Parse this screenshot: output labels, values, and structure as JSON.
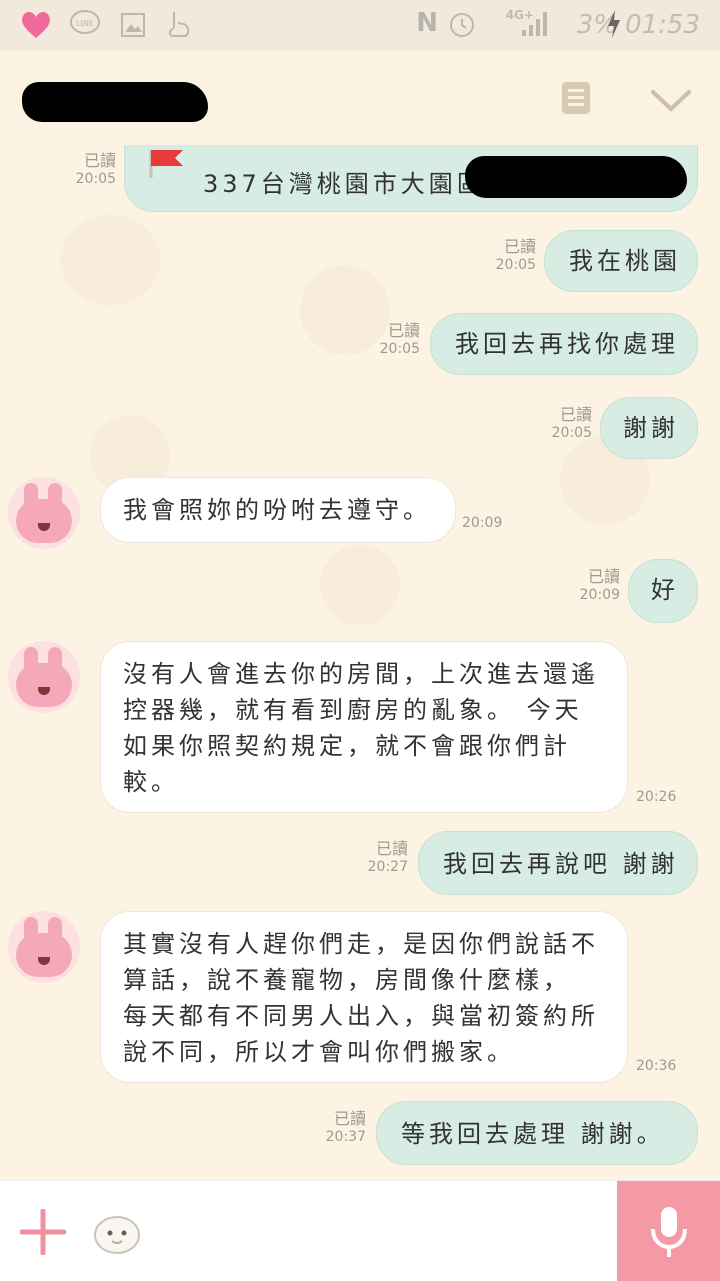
{
  "status_bar": {
    "network": "4G+",
    "nfc": "N",
    "battery": "3%",
    "time": "01:53",
    "icons": [
      "heart-icon",
      "line-icon",
      "gallery-icon",
      "touch-icon",
      "alarm-icon",
      "signal-icon",
      "charging-icon"
    ]
  },
  "header": {
    "icons": [
      "note-icon",
      "chevron-down-icon"
    ]
  },
  "messages": [
    {
      "dir": "out",
      "text": "337台灣桃園市大園區",
      "read": "已讀",
      "time": "20:05"
    },
    {
      "dir": "out",
      "text": "我在桃園",
      "read": "已讀",
      "time": "20:05"
    },
    {
      "dir": "out",
      "text": "我回去再找你處理",
      "read": "已讀",
      "time": "20:05"
    },
    {
      "dir": "out",
      "text": "謝謝",
      "read": "已讀",
      "time": "20:05"
    },
    {
      "dir": "in",
      "text": "我會照妳的吩咐去遵守。",
      "time": "20:09"
    },
    {
      "dir": "out",
      "text": "好",
      "read": "已讀",
      "time": "20:09"
    },
    {
      "dir": "in",
      "text": "沒有人會進去你的房間，上次進去還遙\n控器幾，就有看到廚房的亂象。 今天\n如果你照契約規定，就不會跟你們計\n較。",
      "time": "20:26"
    },
    {
      "dir": "out",
      "text": "我回去再說吧 謝謝",
      "read": "已讀",
      "time": "20:27"
    },
    {
      "dir": "in",
      "text": "其實沒有人趕你們走，是因你們說話不\n算話，說不養寵物，房間像什麼樣，\n每天都有不同男人出入，與當初簽約所\n說不同，所以才會叫你們搬家。",
      "time": "20:36"
    },
    {
      "dir": "out",
      "text": "等我回去處理  謝謝。",
      "read": "已讀",
      "time": "20:37"
    }
  ],
  "colors": {
    "accent_pink": "#f49aa4",
    "bubble_out": "#d7ece2",
    "bubble_in": "#ffffff",
    "background": "#fcf3e2"
  }
}
